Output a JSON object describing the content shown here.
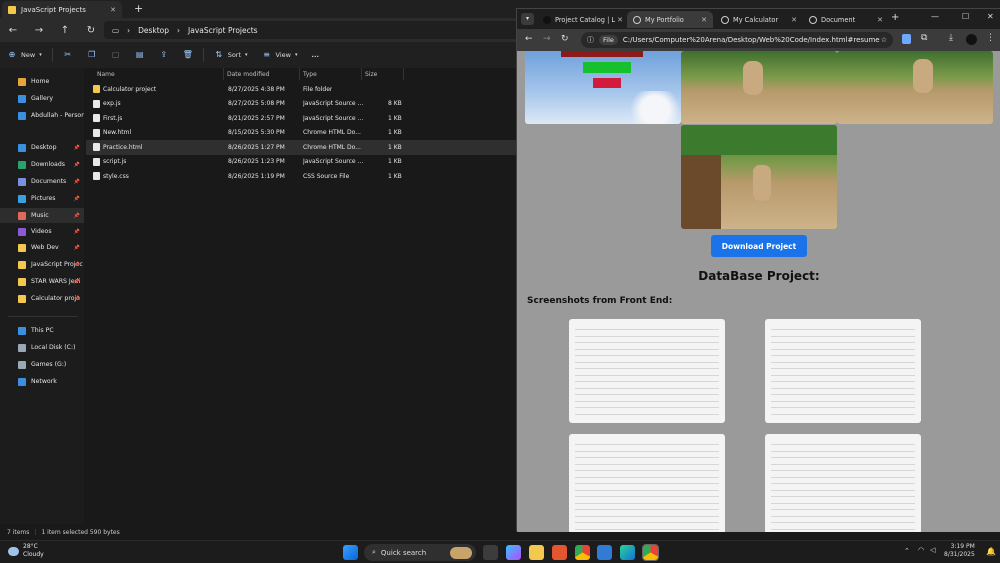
{
  "explorer": {
    "tab_title": "JavaScript Projects",
    "breadcrumb": [
      "Desktop",
      "JavaScript Projects"
    ],
    "commands": {
      "new": "New",
      "sort": "Sort",
      "view": "View",
      "more": "..."
    },
    "nav": [
      {
        "label": "Home",
        "color": "#e8a33c"
      },
      {
        "label": "Gallery",
        "color": "#3b8fe0"
      },
      {
        "label": "Abdullah - Persona",
        "color": "#3b8fe0"
      },
      {
        "label": "Desktop",
        "color": "#3b8fe0"
      },
      {
        "label": "Downloads",
        "color": "#2aa36a"
      },
      {
        "label": "Documents",
        "color": "#7b8fe0"
      },
      {
        "label": "Pictures",
        "color": "#3ba0e0"
      },
      {
        "label": "Music",
        "color": "#e06a5a"
      },
      {
        "label": "Videos",
        "color": "#8b5ad6"
      },
      {
        "label": "Web Dev",
        "color": "#f2c94c"
      },
      {
        "label": "JavaScript Projec",
        "color": "#f2c94c"
      },
      {
        "label": "STAR WARS Jedi",
        "color": "#f2c94c"
      },
      {
        "label": "Calculator proje",
        "color": "#f2c94c"
      },
      {
        "label": "This PC",
        "color": "#3b8fe0"
      },
      {
        "label": "Local Disk (C:)",
        "color": "#9aa7b5"
      },
      {
        "label": "Games (G:)",
        "color": "#9aa7b5"
      },
      {
        "label": "Network",
        "color": "#3b8fe0"
      }
    ],
    "columns": {
      "name": "Name",
      "date": "Date modified",
      "type": "Type",
      "size": "Size"
    },
    "files": [
      {
        "name": "Calculator project",
        "date": "8/27/2025 4:38 PM",
        "type": "File folder",
        "size": "",
        "icon": "folder-icon"
      },
      {
        "name": "exp.js",
        "date": "8/27/2025 5:08 PM",
        "type": "JavaScript Source ...",
        "size": "8 KB",
        "icon": "file-icon"
      },
      {
        "name": "First.js",
        "date": "8/21/2025 2:57 PM",
        "type": "JavaScript Source ...",
        "size": "1 KB",
        "icon": "file-icon"
      },
      {
        "name": "New.html",
        "date": "8/15/2025 5:30 PM",
        "type": "Chrome HTML Do...",
        "size": "1 KB",
        "icon": "file-icon"
      },
      {
        "name": "Practice.html",
        "date": "8/26/2025 1:27 PM",
        "type": "Chrome HTML Do...",
        "size": "1 KB",
        "icon": "file-icon"
      },
      {
        "name": "script.js",
        "date": "8/26/2025 1:23 PM",
        "type": "JavaScript Source ...",
        "size": "1 KB",
        "icon": "file-icon"
      },
      {
        "name": "style.css",
        "date": "8/26/2025 1:19 PM",
        "type": "CSS Source File",
        "size": "1 KB",
        "icon": "file-icon"
      }
    ],
    "status": {
      "count": "7 items",
      "selection": "1 item selected 590 bytes"
    }
  },
  "browser": {
    "tabs": [
      {
        "label": "Project Catalog | L"
      },
      {
        "label": "My Portfolio"
      },
      {
        "label": "My Calculator"
      },
      {
        "label": "Document"
      }
    ],
    "url_chip": "File",
    "url": "C:/Users/Computer%20Arena/Desktop/Web%20Code/Index.html#resume",
    "page": {
      "download_button": "Download Project",
      "db_heading": "DataBase Project:",
      "screenshots_heading": "Screenshots from Front End:"
    }
  },
  "taskbar": {
    "temp": "28°C",
    "condition": "Cloudy",
    "search_placeholder": "Quick search",
    "time": "3:19 PM",
    "date": "8/31/2025"
  }
}
